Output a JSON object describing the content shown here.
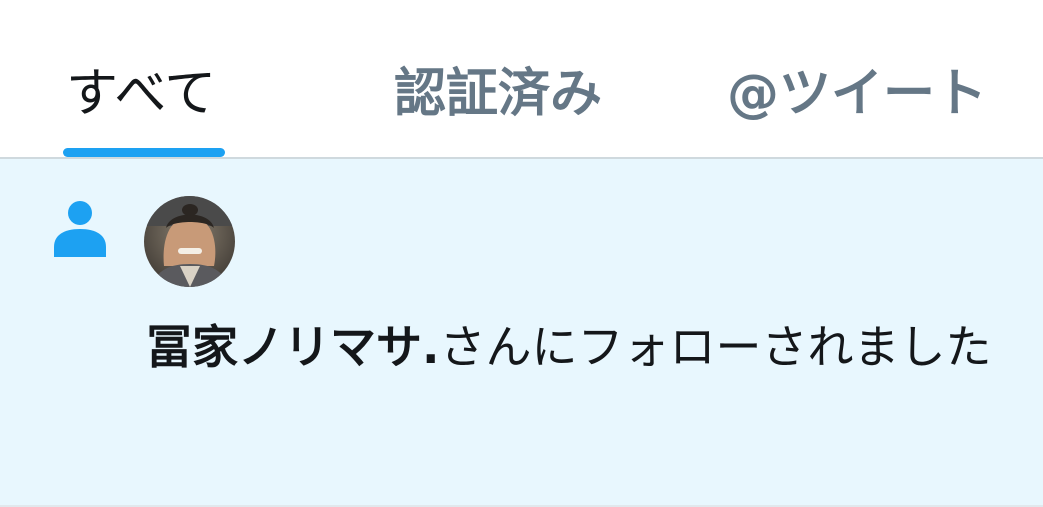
{
  "tabs": {
    "all": "すべて",
    "verified": "認証済み",
    "mentions": "@ツイート"
  },
  "notification": {
    "icon": "person-icon",
    "avatar_description": "user-avatar-photo",
    "user_name": "冨家ノリマサ.",
    "message": "さんにフォローされました"
  },
  "colors": {
    "accent": "#1da1f2",
    "notification_bg": "#e8f7fe",
    "text_primary": "#14171a",
    "text_secondary": "#657786"
  }
}
